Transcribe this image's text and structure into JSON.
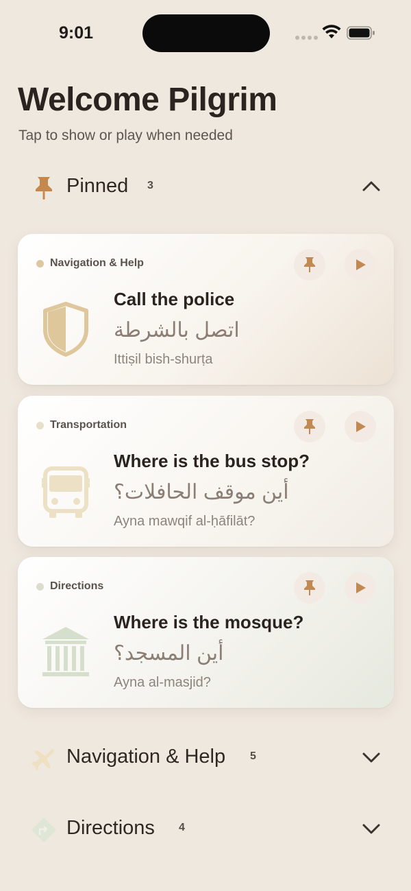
{
  "status_bar": {
    "time": "9:01"
  },
  "header": {
    "title": "Welcome Pilgrim",
    "subtitle": "Tap to show or play when needed"
  },
  "sections": [
    {
      "label": "Pinned",
      "count": "3",
      "icon": "pushpin-icon",
      "expanded": true
    },
    {
      "label": "Navigation & Help",
      "count": "5",
      "icon": "airplane-icon",
      "expanded": false
    },
    {
      "label": "Directions",
      "count": "4",
      "icon": "direction-sign-icon",
      "expanded": false
    }
  ],
  "cards": [
    {
      "category": "Navigation & Help",
      "category_color": "#dcc8a0",
      "icon": "shield-icon",
      "english": "Call the police",
      "arabic": "اتصل بالشرطة",
      "transliteration": "Ittiṣil bish-shurṭa"
    },
    {
      "category": "Transportation",
      "category_color": "#e8dfc8",
      "icon": "bus-icon",
      "english": "Where is the bus stop?",
      "arabic": "أين موقف الحافلات؟",
      "transliteration": "Ayna mawqif al-ḥāfilāt?"
    },
    {
      "category": "Directions",
      "category_color": "#dcddcf",
      "icon": "mosque-building-icon",
      "english": "Where is the mosque?",
      "arabic": "أين المسجد؟",
      "transliteration": "Ayna al-masjid?"
    }
  ],
  "colors": {
    "background": "#efe8df",
    "accent": "#c08a52",
    "text_primary": "#2b231f",
    "text_secondary": "#8c847d"
  }
}
